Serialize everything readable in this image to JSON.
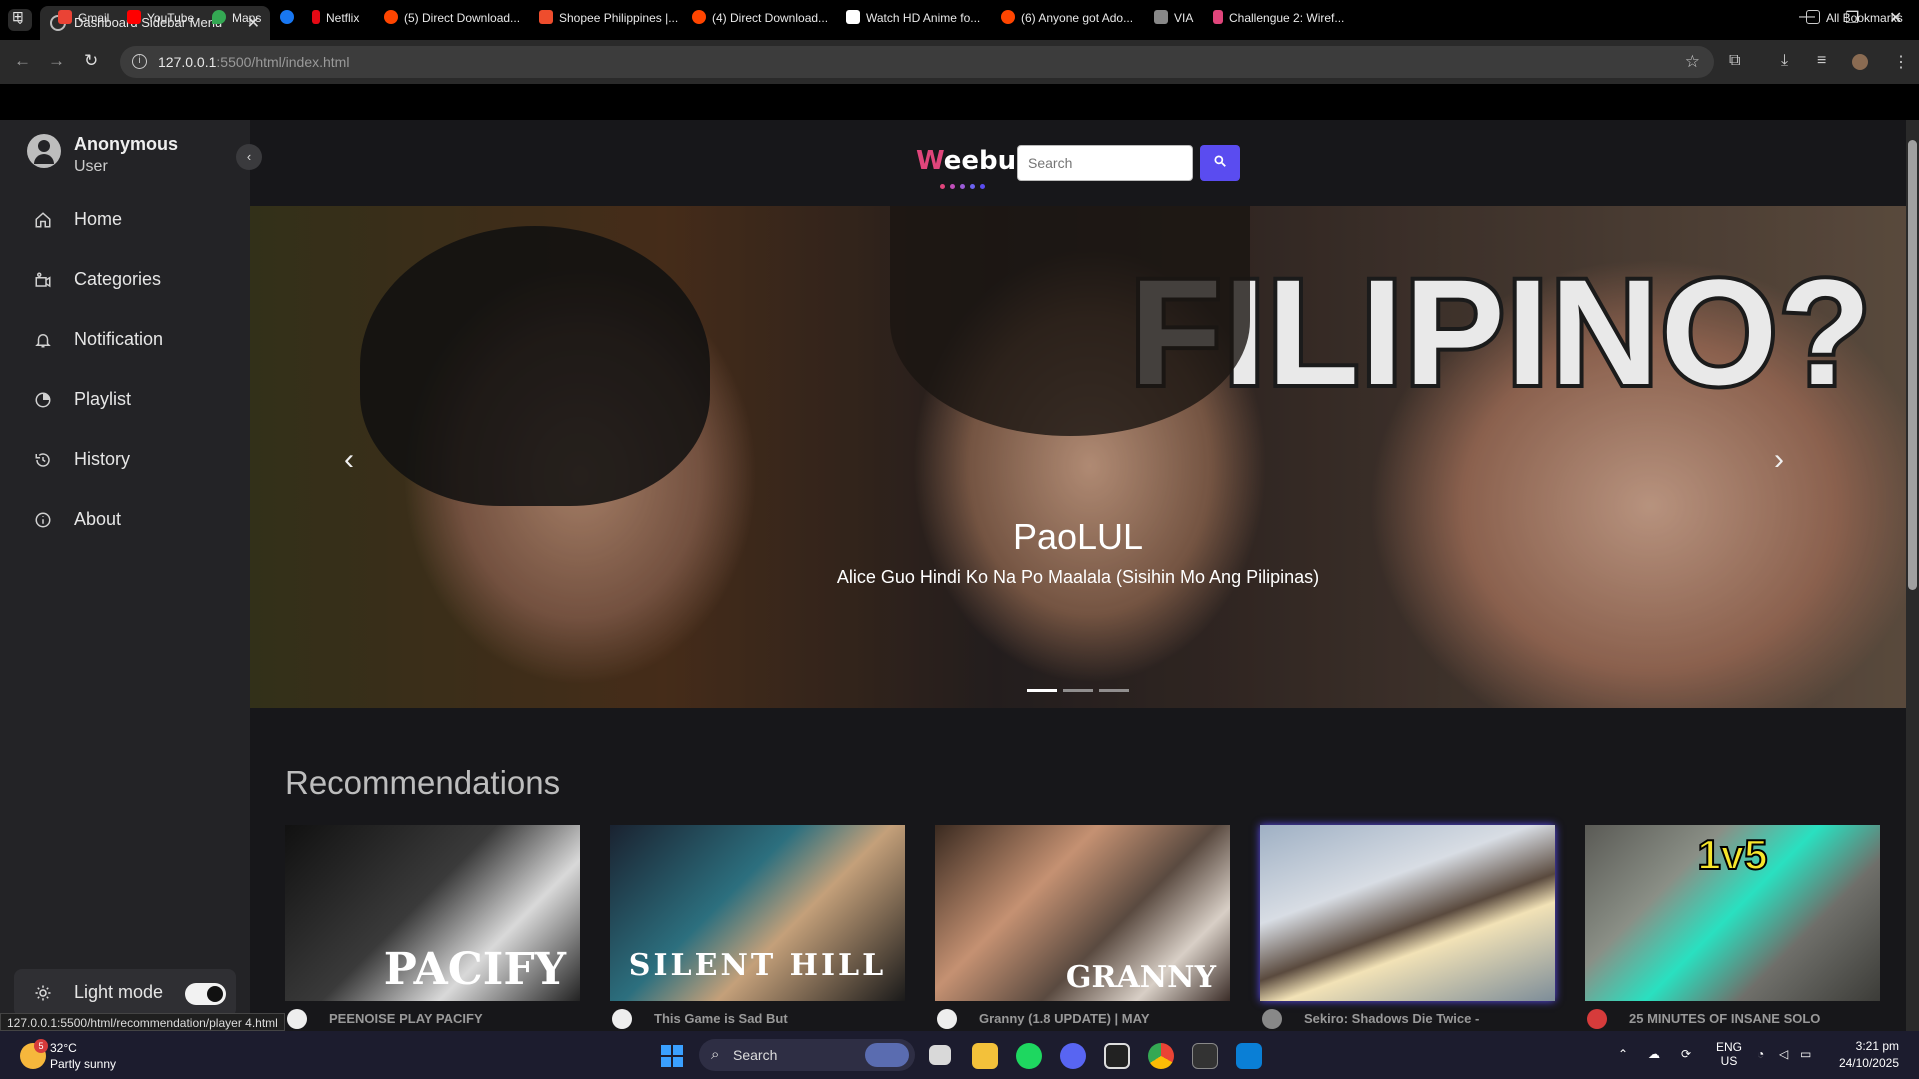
{
  "browser": {
    "tab_title": "Dashboard Sidebar Menu",
    "url_host": "127.0.0.1",
    "url_path": ":5500/html/index.html",
    "bookmarks": [
      {
        "label": "Gmail",
        "color": "#ea4335"
      },
      {
        "label": "YouTube",
        "color": "#ff0000"
      },
      {
        "label": "Maps",
        "color": "#34a853"
      },
      {
        "label": "",
        "color": "#1877f2"
      },
      {
        "label": "Netflix",
        "color": "#e50914"
      },
      {
        "label": "(5) Direct Download...",
        "color": "#ff4500"
      },
      {
        "label": "Shopee Philippines |...",
        "color": "#ee4d2d"
      },
      {
        "label": "(4) Direct Download...",
        "color": "#ff4500"
      },
      {
        "label": "Watch HD Anime fo...",
        "color": "#ffffff"
      },
      {
        "label": "(6) Anyone got Ado...",
        "color": "#ff4500"
      },
      {
        "label": "VIA",
        "color": "#888888"
      },
      {
        "label": "Challengue 2: Wiref...",
        "color": "#e0457b"
      }
    ],
    "all_bookmarks": "All Bookmarks"
  },
  "sidebar": {
    "user_name": "Anonymous",
    "user_role": "User",
    "items": [
      {
        "label": "Home",
        "icon": "home-icon"
      },
      {
        "label": "Categories",
        "icon": "categories-icon"
      },
      {
        "label": "Notification",
        "icon": "bell-icon"
      },
      {
        "label": "Playlist",
        "icon": "clock-icon"
      },
      {
        "label": "History",
        "icon": "history-icon"
      },
      {
        "label": "About",
        "icon": "info-icon"
      }
    ],
    "mode_label": "Light mode"
  },
  "header": {
    "logo_first": "W",
    "logo_rest": "eebu",
    "search_placeholder": "Search"
  },
  "carousel": {
    "headline": "FILIPINO?",
    "title": "PaoLUL",
    "subtitle": "Alice Guo Hindi Ko Na Po Maalala (Sisihin Mo Ang Pilipinas)",
    "slide_count": 3,
    "active_slide": 1
  },
  "recommendations": {
    "heading": "Recommendations",
    "items": [
      {
        "thumb_text": "PACIFY",
        "title": "PEENOISE PLAY PACIFY"
      },
      {
        "thumb_text": "SILENT HILL",
        "title": "This Game is Sad But"
      },
      {
        "thumb_text": "GRANNY",
        "title": "Granny (1.8 UPDATE) | MAY"
      },
      {
        "thumb_text": "",
        "title": "Sekiro: Shadows Die Twice -"
      },
      {
        "thumb_text": "1v5",
        "title": "25 MINUTES OF INSANE SOLO"
      }
    ]
  },
  "status_url": "127.0.0.1:5500/html/recommendation/player 4.html",
  "taskbar": {
    "weather_temp": "32°C",
    "weather_cond": "Partly sunny",
    "weather_badge": "5",
    "search_label": "Search",
    "lang_top": "ENG",
    "lang_bottom": "US",
    "time": "3:21 pm",
    "date": "24/10/2025"
  }
}
